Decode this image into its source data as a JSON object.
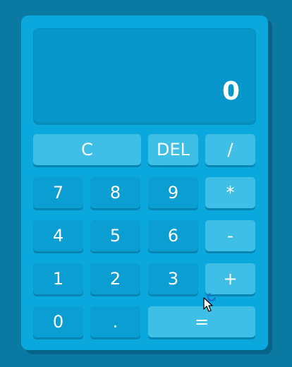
{
  "display": {
    "value": "0"
  },
  "keys": {
    "clear": "C",
    "delete": "DEL",
    "divide": "/",
    "seven": "7",
    "eight": "8",
    "nine": "9",
    "multiply": "*",
    "four": "4",
    "five": "5",
    "six": "6",
    "subtract": "-",
    "one": "1",
    "two": "2",
    "three": "3",
    "add": "+",
    "zero": "0",
    "decimal": ".",
    "equals": "="
  },
  "colors": {
    "background": "#0a7aa3",
    "body": "#0aa8dc",
    "display": "#0796c9",
    "number_key": "#0a9ed3",
    "operator_key": "#3fbfe6",
    "text": "#ffffff"
  },
  "icons": {
    "cursor": "mouse-pointer-icon",
    "busy": "loading-spinner-icon"
  }
}
